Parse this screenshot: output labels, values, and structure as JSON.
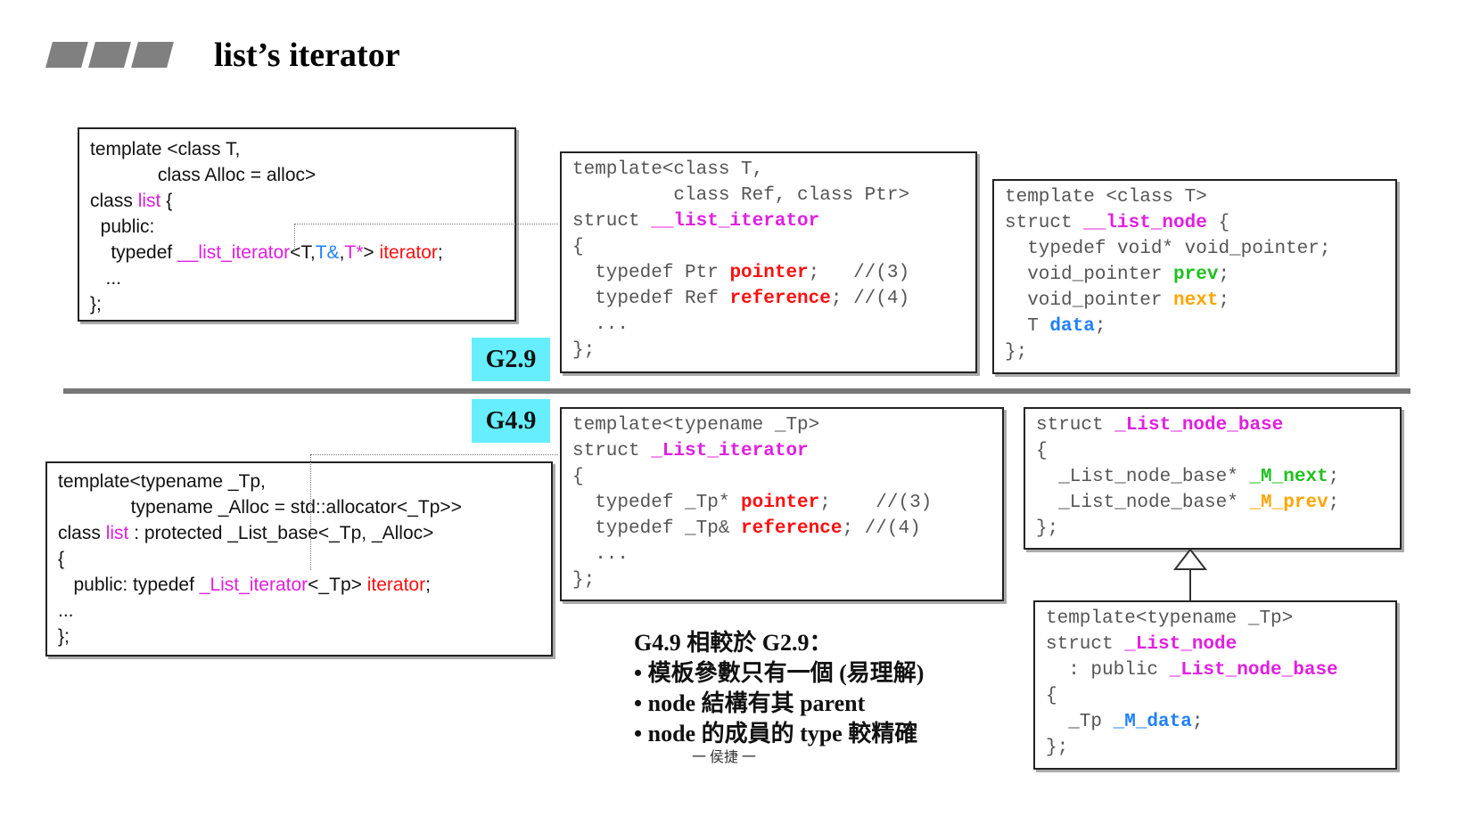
{
  "title": "list’s iterator",
  "colors": {
    "magenta": "#e020e0",
    "red": "#ff1010",
    "blue": "#2080ff",
    "green": "#20c020",
    "orange": "#ffa500",
    "tag_bg": "#66eeff"
  },
  "tags": {
    "g29": "G2.9",
    "g49": "G4.9"
  },
  "boxes": {
    "g29_list": [
      [
        [
          "template <class T,",
          ""
        ]
      ],
      [
        [
          "             class Alloc = alloc>",
          ""
        ]
      ],
      [
        [
          "class ",
          ""
        ],
        [
          "list",
          "magenta"
        ],
        [
          " {",
          ""
        ]
      ],
      [
        [
          "  public:",
          ""
        ]
      ],
      [
        [
          "    typedef ",
          ""
        ],
        [
          "__list_iterator",
          "magenta"
        ],
        [
          "<T,",
          ""
        ],
        [
          "T&",
          "blue"
        ],
        [
          ",",
          ""
        ],
        [
          "T*",
          "magenta"
        ],
        [
          "> ",
          ""
        ],
        [
          "iterator",
          "red"
        ],
        [
          ";",
          ""
        ]
      ],
      [
        [
          "   ...",
          ""
        ]
      ],
      [
        [
          "};",
          ""
        ]
      ]
    ],
    "g29_iterator": [
      [
        [
          "template<class T,",
          ""
        ]
      ],
      [
        [
          "         class Ref, class Ptr>",
          ""
        ]
      ],
      [
        [
          "struct ",
          ""
        ],
        [
          "__list_iterator",
          "magenta"
        ]
      ],
      [
        [
          "{",
          ""
        ]
      ],
      [
        [
          "  typedef Ptr ",
          ""
        ],
        [
          "pointer",
          "red"
        ],
        [
          ";   //(3)",
          ""
        ]
      ],
      [
        [
          "  typedef Ref ",
          ""
        ],
        [
          "reference",
          "red"
        ],
        [
          "; //(4)",
          ""
        ]
      ],
      [
        [
          "  ...",
          ""
        ]
      ],
      [
        [
          "};",
          ""
        ]
      ]
    ],
    "g29_node": [
      [
        [
          "template <class T>",
          ""
        ]
      ],
      [
        [
          "struct ",
          ""
        ],
        [
          "__list_node",
          "magenta"
        ],
        [
          " {",
          ""
        ]
      ],
      [
        [
          "  typedef void* void_pointer;",
          ""
        ]
      ],
      [
        [
          "  void_pointer ",
          ""
        ],
        [
          "prev",
          "green"
        ],
        [
          ";",
          ""
        ]
      ],
      [
        [
          "  void_pointer ",
          ""
        ],
        [
          "next",
          "orange"
        ],
        [
          ";",
          ""
        ]
      ],
      [
        [
          "  T ",
          ""
        ],
        [
          "data",
          "blue"
        ],
        [
          ";",
          ""
        ]
      ],
      [
        [
          "};",
          ""
        ]
      ]
    ],
    "g49_list": [
      [
        [
          "template<typename _Tp,",
          ""
        ]
      ],
      [
        [
          "              typename _Alloc = std::allocator<_Tp>>",
          ""
        ]
      ],
      [
        [
          "class ",
          ""
        ],
        [
          "list",
          "magenta"
        ],
        [
          " : protected _List_base<_Tp, _Alloc>",
          ""
        ]
      ],
      [
        [
          "{",
          ""
        ]
      ],
      [
        [
          "   public: typedef ",
          ""
        ],
        [
          "_List_iterator",
          "magenta"
        ],
        [
          "<_Tp> ",
          ""
        ],
        [
          "iterator",
          "red"
        ],
        [
          ";",
          ""
        ]
      ],
      [
        [
          "...",
          ""
        ]
      ],
      [
        [
          "};",
          ""
        ]
      ]
    ],
    "g49_iterator": [
      [
        [
          "template<typename _Tp>",
          ""
        ]
      ],
      [
        [
          "struct ",
          ""
        ],
        [
          "_List_iterator",
          "magenta"
        ]
      ],
      [
        [
          "{",
          ""
        ]
      ],
      [
        [
          "  typedef _Tp* ",
          ""
        ],
        [
          "pointer",
          "red"
        ],
        [
          ";    //(3)",
          ""
        ]
      ],
      [
        [
          "  typedef _Tp& ",
          ""
        ],
        [
          "reference",
          "red"
        ],
        [
          "; //(4)",
          ""
        ]
      ],
      [
        [
          "  ...",
          ""
        ]
      ],
      [
        [
          "};",
          ""
        ]
      ]
    ],
    "g49_node_base": [
      [
        [
          "struct ",
          ""
        ],
        [
          "_List_node_base",
          "magenta"
        ]
      ],
      [
        [
          "{",
          ""
        ]
      ],
      [
        [
          "  _List_node_base* ",
          ""
        ],
        [
          "_M_next",
          "green"
        ],
        [
          ";",
          ""
        ]
      ],
      [
        [
          "  _List_node_base* ",
          ""
        ],
        [
          "_M_prev",
          "orange"
        ],
        [
          ";",
          ""
        ]
      ],
      [
        [
          "};",
          ""
        ]
      ]
    ],
    "g49_node": [
      [
        [
          "template<typename _Tp>",
          ""
        ]
      ],
      [
        [
          "struct ",
          ""
        ],
        [
          "_List_node",
          "magenta"
        ]
      ],
      [
        [
          "  : public ",
          ""
        ],
        [
          "_List_node_base",
          "magenta"
        ]
      ],
      [
        [
          "{",
          ""
        ]
      ],
      [
        [
          "  _Tp ",
          ""
        ],
        [
          "_M_data",
          "blue"
        ],
        [
          ";",
          ""
        ]
      ],
      [
        [
          "};",
          ""
        ]
      ]
    ]
  },
  "notes": {
    "heading": "G4.9 相較於 G2.9：",
    "items": [
      "• 模板參數只有一個 (易理解)",
      "• node 結構有其 parent",
      "• node 的成員的 type 較精確"
    ]
  },
  "footer": "一 侯捷 一"
}
